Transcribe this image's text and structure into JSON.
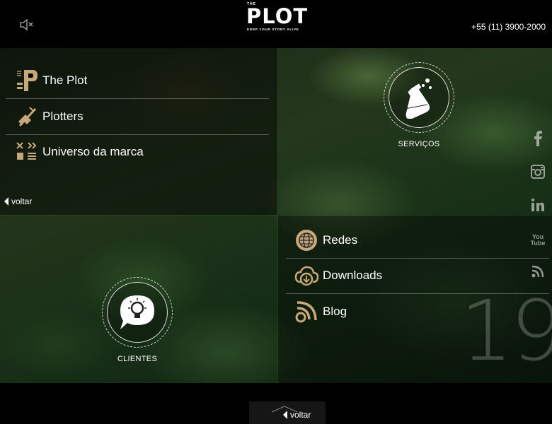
{
  "header": {
    "logo_the": "THE",
    "logo_name": "PLOT",
    "logo_tagline": "KEEP YOUR STORY ALIVE",
    "phone": "+55 (11) 3900-2000",
    "mute_icon": "speaker-muted-icon"
  },
  "menu_left": {
    "items": [
      {
        "label": "The Plot",
        "icon": "the-plot-icon"
      },
      {
        "label": "Plotters",
        "icon": "plotters-icon"
      },
      {
        "label": "Universo da marca",
        "icon": "universe-icon"
      }
    ],
    "back_label": "voltar"
  },
  "services": {
    "label": "SERVIÇOS",
    "icon": "flask-icon"
  },
  "clients": {
    "label": "CLIENTES",
    "icon": "lightbulb-bubble-icon"
  },
  "menu_right": {
    "items": [
      {
        "label": "Redes",
        "icon": "globe-icon"
      },
      {
        "label": "Downloads",
        "icon": "cloud-download-icon"
      },
      {
        "label": "Blog",
        "icon": "blog-rss-icon"
      }
    ]
  },
  "social": [
    "facebook-icon",
    "instagram-icon",
    "linkedin-icon",
    "youtube-icon",
    "rss-icon"
  ],
  "social_youtube_text": [
    "You",
    "Tube"
  ],
  "page_number": "19",
  "footer": {
    "back_label": "voltar"
  },
  "colors": {
    "accent": "#c8a878",
    "background": "#000000"
  }
}
